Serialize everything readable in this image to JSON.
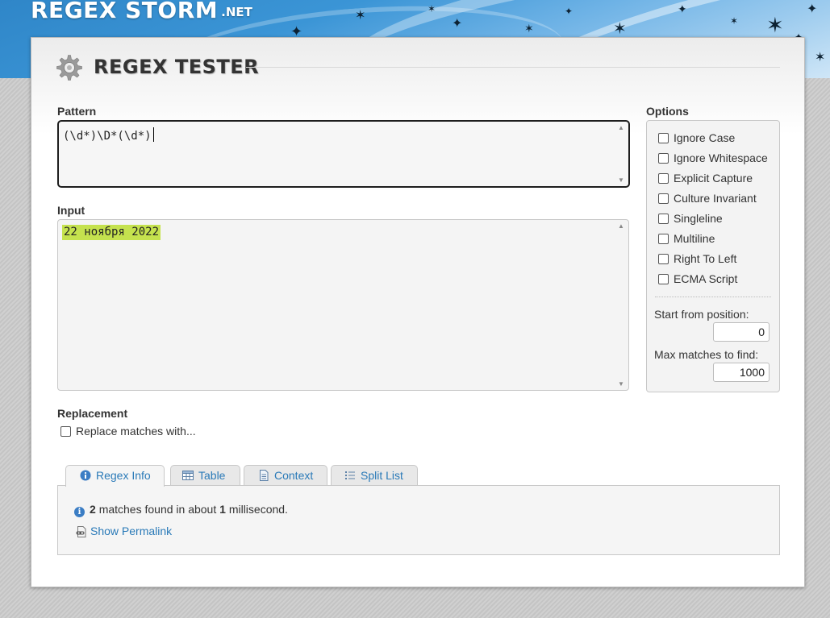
{
  "header": {
    "logo": "REGEX STORM",
    "logo_tld": ".NET"
  },
  "page": {
    "title": "REGEX TESTER"
  },
  "pattern": {
    "label": "Pattern",
    "value": "(\\d*)\\D*(\\d*)"
  },
  "input": {
    "label": "Input",
    "value": "22 ноября 2022"
  },
  "options": {
    "label": "Options",
    "checkboxes": [
      {
        "label": "Ignore Case",
        "checked": false
      },
      {
        "label": "Ignore Whitespace",
        "checked": false
      },
      {
        "label": "Explicit Capture",
        "checked": false
      },
      {
        "label": "Culture Invariant",
        "checked": false
      },
      {
        "label": "Singleline",
        "checked": false
      },
      {
        "label": "Multiline",
        "checked": false
      },
      {
        "label": "Right To Left",
        "checked": false
      },
      {
        "label": "ECMA Script",
        "checked": false
      }
    ],
    "start_label": "Start from position:",
    "start_value": "0",
    "max_label": "Max matches to find:",
    "max_value": "1000"
  },
  "replacement": {
    "label": "Replacement",
    "checkbox_label": "Replace matches with..."
  },
  "tabs": [
    {
      "label": "Regex Info",
      "icon": "info-icon"
    },
    {
      "label": "Table",
      "icon": "table-icon"
    },
    {
      "label": "Context",
      "icon": "document-icon"
    },
    {
      "label": "Split List",
      "icon": "list-icon"
    }
  ],
  "results": {
    "match_count": "2",
    "text_matches": "matches found in about",
    "duration": "1",
    "text_unit": "millisecond.",
    "permalink_label": "Show Permalink"
  },
  "colors": {
    "accent_link": "#2a7ab8",
    "match_highlight": "#c5e24e",
    "banner_blue": "#2f86c8"
  }
}
